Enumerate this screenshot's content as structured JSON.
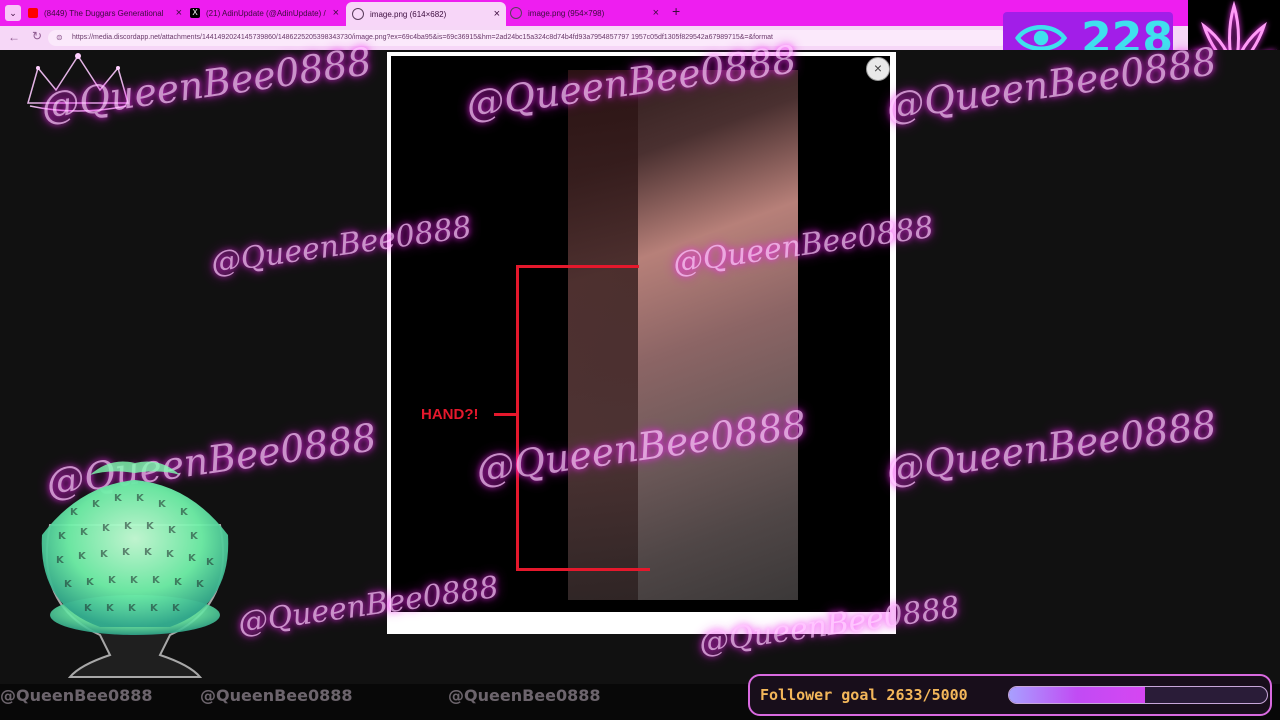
{
  "browser": {
    "tabs": [
      {
        "title": "(8449) The Duggars Generational",
        "favicon_color": "#ff0000"
      },
      {
        "title": "(21) AdinUpdate (@AdinUpdate) /",
        "favicon_color": "#000000"
      },
      {
        "title": "image.png (614×682)",
        "favicon_color": "#5a3d5c"
      },
      {
        "title": "image.png (954×798)",
        "favicon_color": "#5a3d5c"
      }
    ],
    "new_tab_label": "+",
    "url": "https://media.discordapp.net/attachments/1441492024145739860/1486225205398343730/image.png?ex=69c4ba95&is=69c36915&hm=2ad24bc15a324c8d74b4fd93a7954857797 1957c05df1305f829542a67989715&=&format"
  },
  "overlay": {
    "viewer_count": "228",
    "follower_goal_label": "Follower goal 2633/5000",
    "follower_goal_fraction": 0.5266,
    "watermark": "@QueenBee0888"
  },
  "image": {
    "annotation": "HAND?!",
    "close_symbol": "×"
  },
  "colors": {
    "tabbar": "#ee1ef0",
    "watermark_glow": "#ff36ff",
    "annotation_red": "#e5182c",
    "viewer_badge": "#a21ee8",
    "viewer_text": "#3fe0ee",
    "goal_text": "#f3b75a"
  }
}
